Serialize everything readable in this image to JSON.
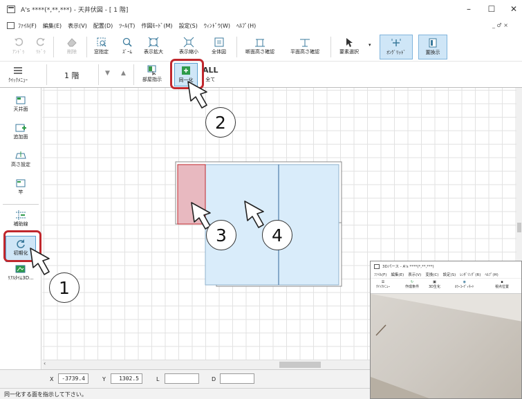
{
  "window": {
    "title": "A's ****(*,**,***) - 天井伏図 - [ 1 階]",
    "minimize": "–",
    "maximize": "☐",
    "close": "✕",
    "mdi_controls": "_ ♂ ×"
  },
  "menu": [
    "ﾌｧｲﾙ(F)",
    "編集(E)",
    "表示(V)",
    "配置(D)",
    "ﾂｰﾙ(T)",
    "作図ﾓｰﾄﾞ(M)",
    "設定(S)",
    "ｳｨﾝﾄﾞｳ(W)",
    "ﾍﾙﾌﾟ(H)"
  ],
  "toolbar1": [
    {
      "label": "ｱﾝﾄﾞｩ",
      "icon": "undo-icon",
      "disabled": true
    },
    {
      "label": "ﾘﾄﾞｩ",
      "icon": "redo-icon",
      "disabled": true
    },
    {
      "label": "削除",
      "icon": "eraser-icon",
      "disabled": true
    },
    {
      "label": "窓指定",
      "icon": "window-select-icon",
      "disabled": false
    },
    {
      "label": "ｽﾞｰﾑ",
      "icon": "zoom-icon",
      "disabled": false
    },
    {
      "label": "表示拡大",
      "icon": "zoom-in-icon",
      "disabled": false
    },
    {
      "label": "表示縮小",
      "icon": "zoom-out-icon",
      "disabled": false
    },
    {
      "label": "全体図",
      "icon": "fit-all-icon",
      "disabled": false
    },
    {
      "label": "断面高さ確認",
      "icon": "section-height-icon",
      "disabled": false
    },
    {
      "label": "平面高さ確認",
      "icon": "plan-height-icon",
      "disabled": false
    },
    {
      "label": "要素選択",
      "icon": "cursor-icon",
      "disabled": false
    },
    {
      "label": "ｵﾝｸﾞﾘｯﾄﾞ",
      "icon": "on-grid-icon",
      "disabled": false
    },
    {
      "label": "置換示",
      "icon": "display-icon",
      "disabled": false
    }
  ],
  "toolbar2": {
    "quick_menu": "ｸｲｯｸﾒﾆｭｰ",
    "floor": "1 階",
    "room_select": "部屋指示",
    "unify": "同一化",
    "all_icon_text": "ALL",
    "all": "全て"
  },
  "left_toolbar": [
    {
      "label": "天井面",
      "icon": "ceiling-icon"
    },
    {
      "label": "追加面",
      "icon": "add-face-icon"
    },
    {
      "label": "高さ設定",
      "icon": "height-set-icon"
    },
    {
      "label": "竿",
      "icon": "rod-icon"
    },
    {
      "label": "補助線",
      "icon": "guide-line-icon"
    },
    {
      "label": "初期化",
      "icon": "reset-icon"
    },
    {
      "label": "ﾘｱﾙﾀｲﾑ3D...",
      "icon": "realtime-3d-icon"
    }
  ],
  "coords": {
    "x_label": "X",
    "x": "-3739.4",
    "y_label": "Y",
    "y": "1302.5",
    "l_label": "L",
    "d_label": "D"
  },
  "status": "同一化する面を指示して下さい。",
  "callouts": [
    "1",
    "2",
    "3",
    "4"
  ],
  "colors": {
    "highlight": "#c0272d",
    "selected_face": "#e8b9c0",
    "face": "#d9ecfa",
    "face_edge": "#8fb2cc"
  },
  "inset": {
    "title": "3Dパース - A's ****(*,**,***)",
    "menu": [
      "ﾌｧｲﾙ(F)",
      "編集(E)",
      "表示(V)",
      "変換(C)",
      "設定(S)",
      "ﾚﾝﾀﾞﾘﾝｸﾞ(R)",
      "ﾍﾙﾌﾟ(H)"
    ],
    "toolbar": [
      "ｸｲｯｸﾒﾆｭｰ",
      "作成条件",
      "3D生化",
      "ｶﾗｰｺｰﾃﾞｨﾈｰﾄ",
      "視点位置"
    ]
  }
}
